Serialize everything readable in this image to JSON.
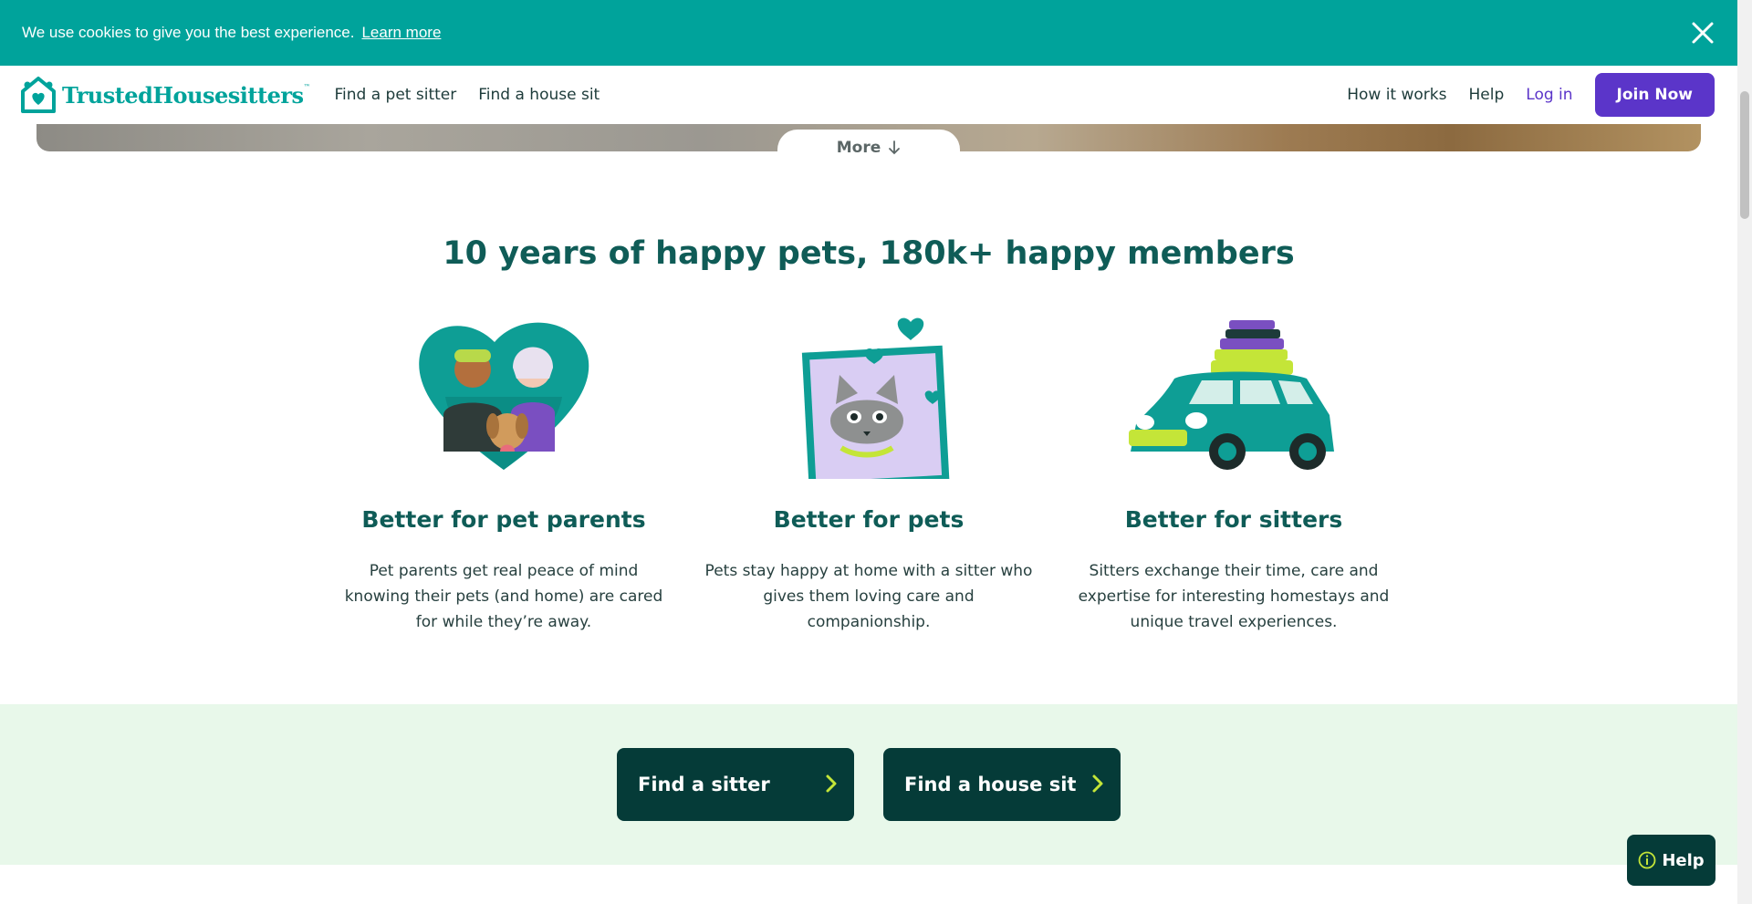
{
  "cookie": {
    "message": "We use cookies to give you the best experience.",
    "link": "Learn more"
  },
  "header": {
    "logo": "TrustedHousesitters",
    "nav_left": [
      "Find a pet sitter",
      "Find a house sit"
    ],
    "how_it_works": "How it works",
    "help": "Help",
    "login": "Log in",
    "join": "Join Now"
  },
  "more": "More",
  "headline": "10 years of happy pets, 180k+ happy members",
  "columns": [
    {
      "title": "Better for pet parents",
      "text": "Pet parents get real peace of mind knowing their pets (and home) are cared for while they’re away."
    },
    {
      "title": "Better for pets",
      "text": "Pets stay happy at home with a sitter who gives them loving care and companionship."
    },
    {
      "title": "Better for sitters",
      "text": "Sitters exchange their time, care and expertise for interesting homestays and unique travel experiences."
    }
  ],
  "cta": {
    "find_sitter": "Find a sitter",
    "find_house_sit": "Find a house sit"
  },
  "help_button": "Help",
  "colors": {
    "teal": "#00a39b",
    "dark_teal": "#053b38",
    "purple": "#5b35c9",
    "mint": "#e8f8ea",
    "lime": "#c4e538"
  }
}
